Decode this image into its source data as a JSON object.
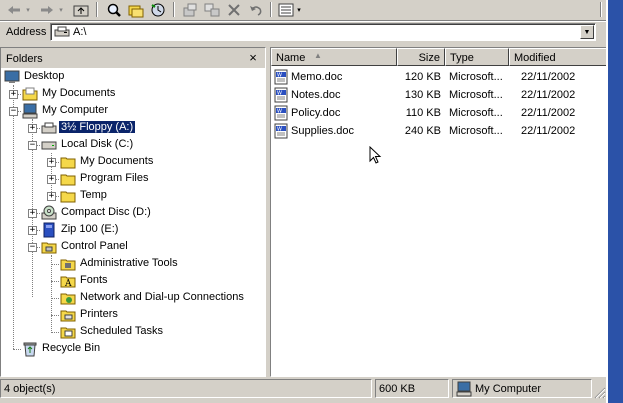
{
  "address": {
    "label": "Address",
    "value": "A:\\"
  },
  "folders_pane": {
    "title": "Folders",
    "close": "×"
  },
  "tree": [
    {
      "label": "Desktop"
    },
    {
      "label": "My Documents"
    },
    {
      "label": "My Computer"
    },
    {
      "label": "3½ Floppy (A:)",
      "selected": true
    },
    {
      "label": "Local Disk (C:)"
    },
    {
      "label": "My Documents"
    },
    {
      "label": "Program Files"
    },
    {
      "label": "Temp"
    },
    {
      "label": "Compact Disc (D:)"
    },
    {
      "label": "Zip 100  (E:)"
    },
    {
      "label": "Control Panel"
    },
    {
      "label": "Administrative Tools"
    },
    {
      "label": "Fonts"
    },
    {
      "label": "Network and Dial-up Connections"
    },
    {
      "label": "Printers"
    },
    {
      "label": "Scheduled Tasks"
    },
    {
      "label": "Recycle Bin"
    }
  ],
  "columns": {
    "name": "Name",
    "size": "Size",
    "type": "Type",
    "modified": "Modified"
  },
  "files": [
    {
      "name": "Memo.doc",
      "size": "120 KB",
      "type": "Microsoft...",
      "modified": "22/11/2002"
    },
    {
      "name": "Notes.doc",
      "size": "130 KB",
      "type": "Microsoft...",
      "modified": "22/11/2002"
    },
    {
      "name": "Policy.doc",
      "size": "110 KB",
      "type": "Microsoft...",
      "modified": "22/11/2002"
    },
    {
      "name": "Supplies.doc",
      "size": "240 KB",
      "type": "Microsoft...",
      "modified": "22/11/2002"
    }
  ],
  "status": {
    "objects": "4 object(s)",
    "size": "600 KB",
    "location": "My Computer"
  },
  "icons": [
    "back-icon",
    "forward-icon",
    "up-folder-icon",
    "search-icon",
    "folders-icon",
    "history-icon",
    "move-to-icon",
    "copy-to-icon",
    "delete-icon",
    "undo-icon",
    "views-icon"
  ]
}
